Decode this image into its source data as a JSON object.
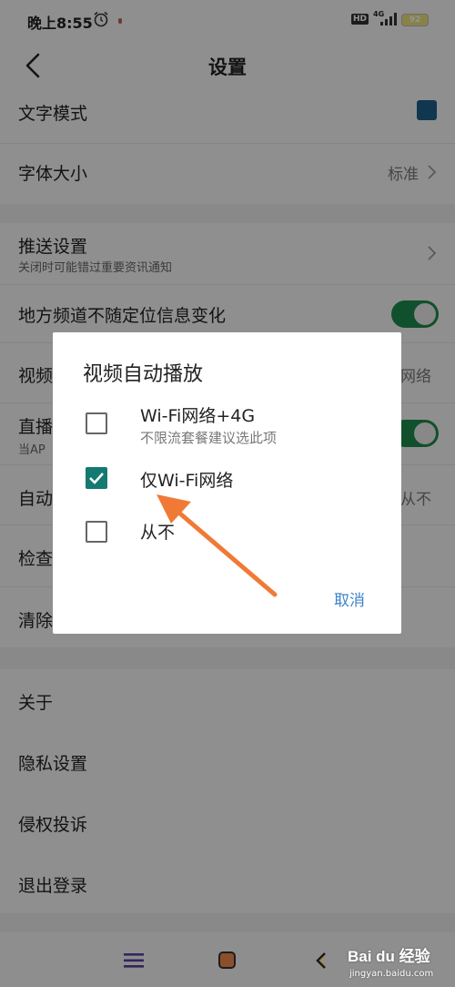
{
  "status_bar": {
    "time": "晚上8:55",
    "hd_badge": "HD",
    "network": "4G",
    "battery": "92"
  },
  "header": {
    "title": "设置"
  },
  "settings": {
    "text_mode": "文字模式",
    "font_size": {
      "label": "字体大小",
      "value": "标准"
    },
    "push": {
      "label": "推送设置",
      "sub": "关闭时可能错过重要资讯通知"
    },
    "local_channel": "地方频道不随定位信息变化",
    "video_autoplay": {
      "label": "视频",
      "value": "网络"
    },
    "live": {
      "label": "直播",
      "sub": "当AP"
    },
    "auto": {
      "label": "自动",
      "value": "从不"
    },
    "check": "检查",
    "clear": "清除",
    "about": "关于",
    "privacy": "隐私设置",
    "complaint": "侵权投诉",
    "logout": "退出登录"
  },
  "dialog": {
    "title": "视频自动播放",
    "options": [
      {
        "label": "Wi-Fi网络+4G",
        "sub": "不限流套餐建议选此项",
        "checked": false
      },
      {
        "label": "仅Wi-Fi网络",
        "checked": true
      },
      {
        "label": "从不",
        "checked": false
      }
    ],
    "cancel": "取消"
  },
  "watermark": {
    "logo": "Bai du 经验",
    "url": "jingyan.baidu.com"
  },
  "colors": {
    "checkbox_on": "#127a70",
    "toggle_on": "#1d8a4d",
    "cancel_link": "#3c84c8",
    "arrow": "#f07a35"
  }
}
